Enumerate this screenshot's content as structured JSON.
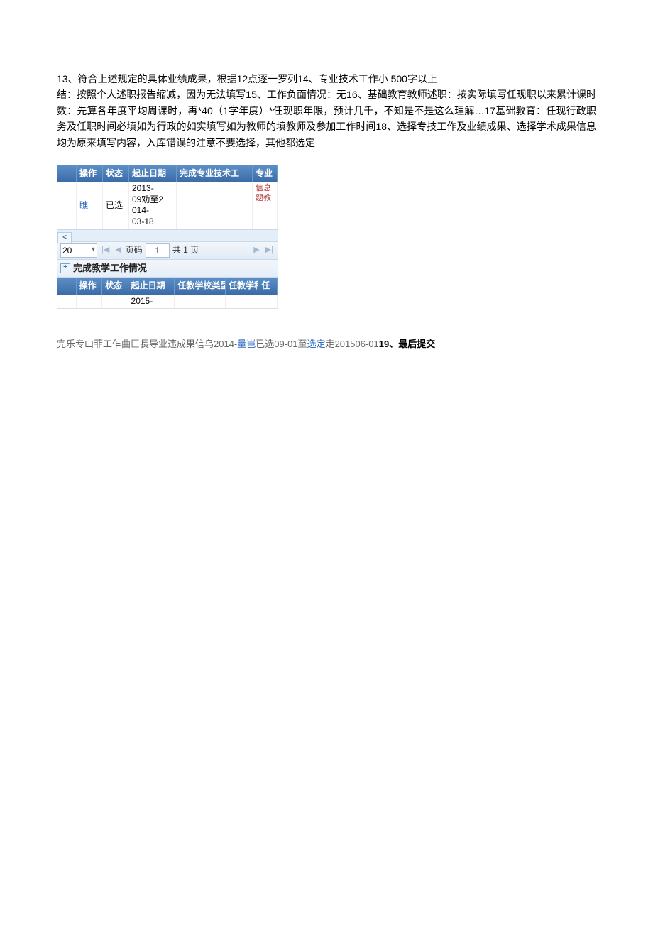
{
  "paragraph": {
    "text": "13、符合上述规定的具体业绩成果，根据12点逐一罗列14、专业技术工作小  500字以上\n结：按照个人述职报告缩减，因为无法填写15、工作负面情况：无16、基础教育教师述职：按实际填写任现职以来累计课时数：先算各年度平均周课时，再*40（1学年度）*任现职年限，预计几千，不知是不是这么理解…17基础教育：任现行政职务及任职时间必填如为行政的如实填写如为教师的填教师及参加工作时间18、选择专技工作及业绩成果、选择学术成果信息均为原来填写内容，入库错误的注意不要选择，其他都选定"
  },
  "table1": {
    "headers": {
      "op": "操作",
      "status": "状态",
      "date": "起止日期",
      "work": "完成专业技术工",
      "right": "专业"
    },
    "row": {
      "op_link": "瞧",
      "status": "已选",
      "date_lines": [
        "2013-",
        "09劝至2",
        "014-",
        "03-18"
      ],
      "right_lines": [
        "信息",
        "题教"
      ]
    }
  },
  "pager": {
    "page_size": "20",
    "page_label": "页码",
    "current_page": "1",
    "total_label": "共 1 页"
  },
  "section2": {
    "title": "完成教学工作情况",
    "headers": {
      "op": "操作",
      "status": "状态",
      "date": "起止日期",
      "type": "任教学校类型",
      "subj": "任教学科",
      "ren": "任"
    },
    "row": {
      "date": "2015-"
    }
  },
  "bottom": {
    "left": "完乐专山菲工乍曲匚長导业违成果信乌2014-",
    "link1": "量岂",
    "mid1": "已选",
    "mid2": "09-01至",
    "link2": "选定",
    "mid3": "走",
    "mid4": "201506-01",
    "strong": "19、最后提交"
  }
}
